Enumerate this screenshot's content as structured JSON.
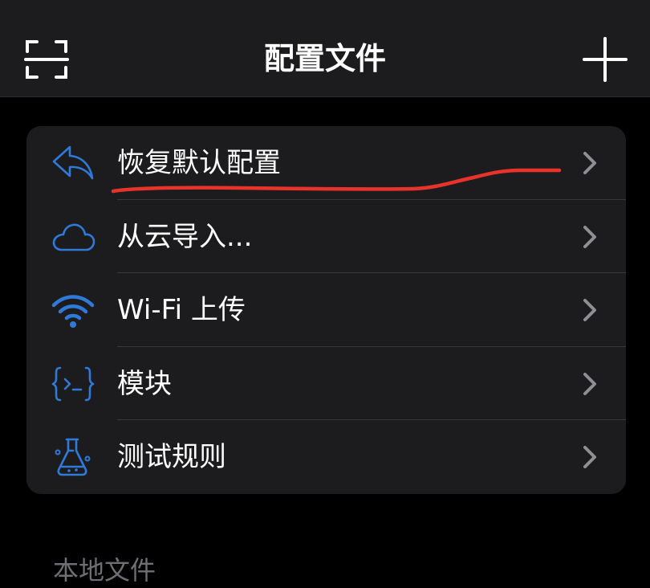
{
  "navbar": {
    "title": "配置文件",
    "left_icon": "scan-icon",
    "right_icon": "plus-icon"
  },
  "menu": {
    "items": [
      {
        "label": "恢复默认配置",
        "icon": "reply-arrow-icon"
      },
      {
        "label": "从云导入...",
        "icon": "cloud-icon"
      },
      {
        "label": "Wi-Fi 上传",
        "icon": "wifi-icon"
      },
      {
        "label": "模块",
        "icon": "code-braces-icon"
      },
      {
        "label": "测试规则",
        "icon": "flask-icon"
      }
    ]
  },
  "section": {
    "header": "本地文件"
  },
  "colors": {
    "background": "#000000",
    "surface": "#1c1c1e",
    "accent_blue": "#2f7ad8",
    "annotation_red": "#e8332a",
    "chevron": "#8e8e93"
  }
}
